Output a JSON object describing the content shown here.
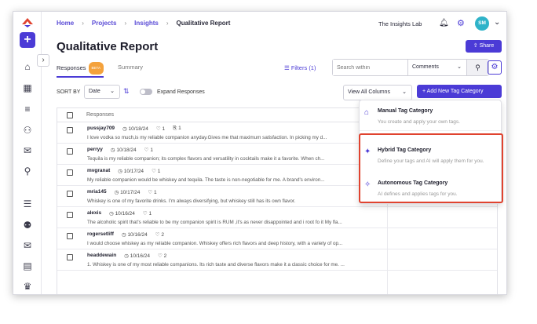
{
  "breadcrumb": {
    "home": "Home",
    "projects": "Projects",
    "insights": "Insights",
    "current": "Qualitative Report"
  },
  "header": {
    "org": "The Insights Lab",
    "avatar_initials": "SM",
    "title": "Qualitative Report",
    "share_label": "Share"
  },
  "tabs": {
    "responses": "Responses",
    "beta": "BETA",
    "summary": "Summary"
  },
  "toolbar": {
    "filters": "Filters (1)",
    "search_placeholder": "Search within",
    "search_scope": "Comments"
  },
  "sort": {
    "label": "SORT BY",
    "value": "Date",
    "expand_label": "Expand Responses",
    "view_columns": "View All Columns",
    "add_tag": "Add New Tag Category"
  },
  "table": {
    "header": "Responses",
    "rows": [
      {
        "user": "pussjay709",
        "date": "10/18/24",
        "likes": "1",
        "attach": "1",
        "text": "I love vodka so much,is my reliable companion anyday.Gives me that maximum satisfaction. In picking my d..."
      },
      {
        "user": "perryy",
        "date": "10/18/24",
        "likes": "1",
        "text": "Tequila is my reliable companion; its complex flavors and versatility in cocktails make it a favorite. When ch..."
      },
      {
        "user": "mvgranat",
        "date": "10/17/24",
        "likes": "1",
        "text": "My reliable companion would be whiskey and tequila. The taste is non-negotiable for me. A brand's environ..."
      },
      {
        "user": "mria145",
        "date": "10/17/24",
        "likes": "1",
        "text": "Whiskey is one of my favorite drinks. I'm always diversifying, but whiskey still has its own flavor."
      },
      {
        "user": "alexis",
        "date": "10/16/24",
        "likes": "1",
        "text": "The alcoholic spirit that's reliable to be my companion spirit is RUM ,it's as never disappointed and i root fo it My fla..."
      },
      {
        "user": "rogersetliff",
        "date": "10/16/24",
        "likes": "2",
        "text": "I would choose whiskey as my reliable companion. Whiskey offers rich flavors and deep history, with a variety of op..."
      },
      {
        "user": "headdewain",
        "date": "10/16/24",
        "likes": "2",
        "text": "1. Whiskey is one of my most reliable companions. Its rich taste and diverse flavors make it a classic choice for me. ..."
      }
    ]
  },
  "dropdown": {
    "options": [
      {
        "title": "Manual Tag Category",
        "desc": "You create and apply your own tags."
      },
      {
        "title": "Hybrid Tag Category",
        "desc": "Define your tags and AI will apply them for you."
      },
      {
        "title": "Autonomous Tag Category",
        "desc": "AI defines and applies tags for you."
      }
    ]
  },
  "colors": {
    "accent": "#4b3bd6",
    "beta": "#f4a23c",
    "highlight": "#e0432f",
    "avatar": "#2fb3c9"
  }
}
